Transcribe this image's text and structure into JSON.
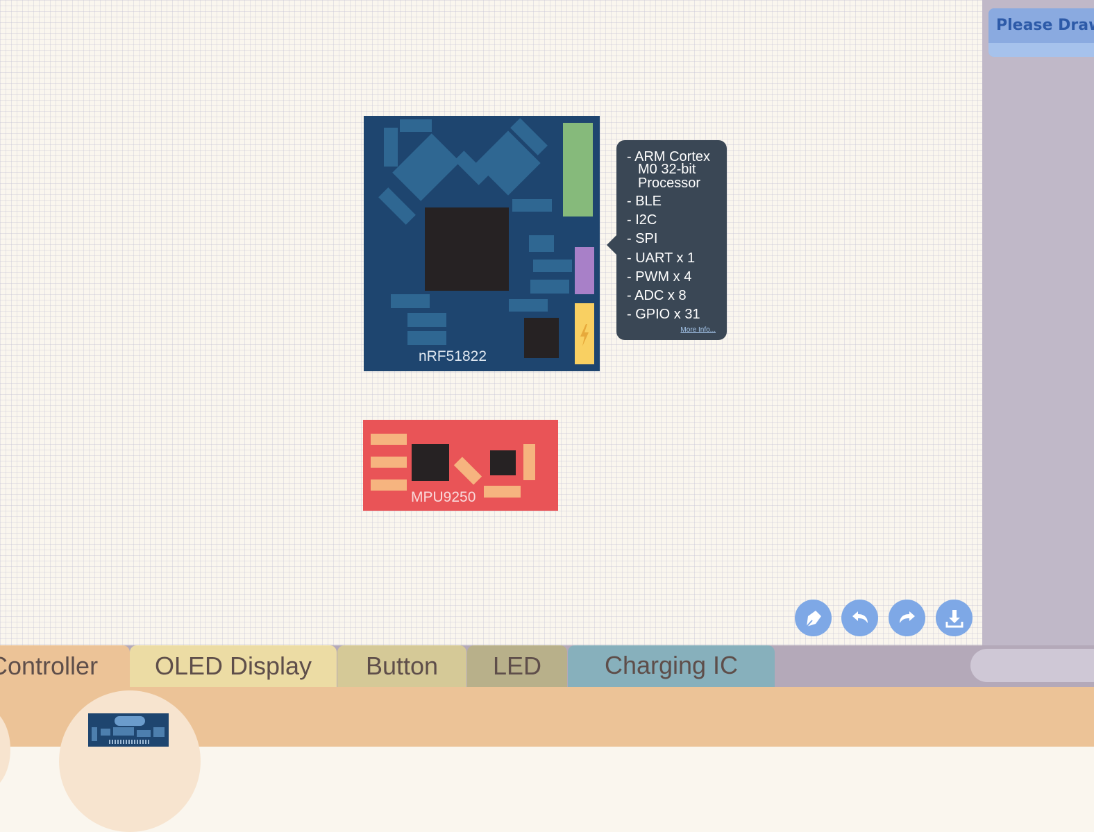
{
  "header": {
    "draw_button_label": "Please Draw"
  },
  "boards": {
    "nrf": {
      "label": "nRF51822",
      "tooltip": {
        "features": [
          "- ARM Cortex",
          "M0 32-bit",
          "Processor",
          "- BLE",
          "- I2C",
          "- SPI",
          "- UART x 1",
          "- PWM x 4",
          "- ADC x 8",
          "- GPIO x 31"
        ],
        "more_info": "More Info..."
      }
    },
    "mpu": {
      "label": "MPU9250"
    }
  },
  "toolbar": {
    "buttons": [
      "pen-icon",
      "undo-icon",
      "redo-icon",
      "download-icon"
    ]
  },
  "tabs": [
    {
      "label": "Controller",
      "color": "#ecc397"
    },
    {
      "label": "OLED Display",
      "color": "#ecdca4"
    },
    {
      "label": "Button",
      "color": "#d5c997"
    },
    {
      "label": "LED",
      "color": "#b8b08a"
    },
    {
      "label": "Charging IC",
      "color": "#87b0bc"
    }
  ],
  "colors": {
    "board_blue": "#1e456f",
    "board_red": "#e95457",
    "accent_blue": "#7ea8e6",
    "tooltip_bg": "#3a4755"
  }
}
